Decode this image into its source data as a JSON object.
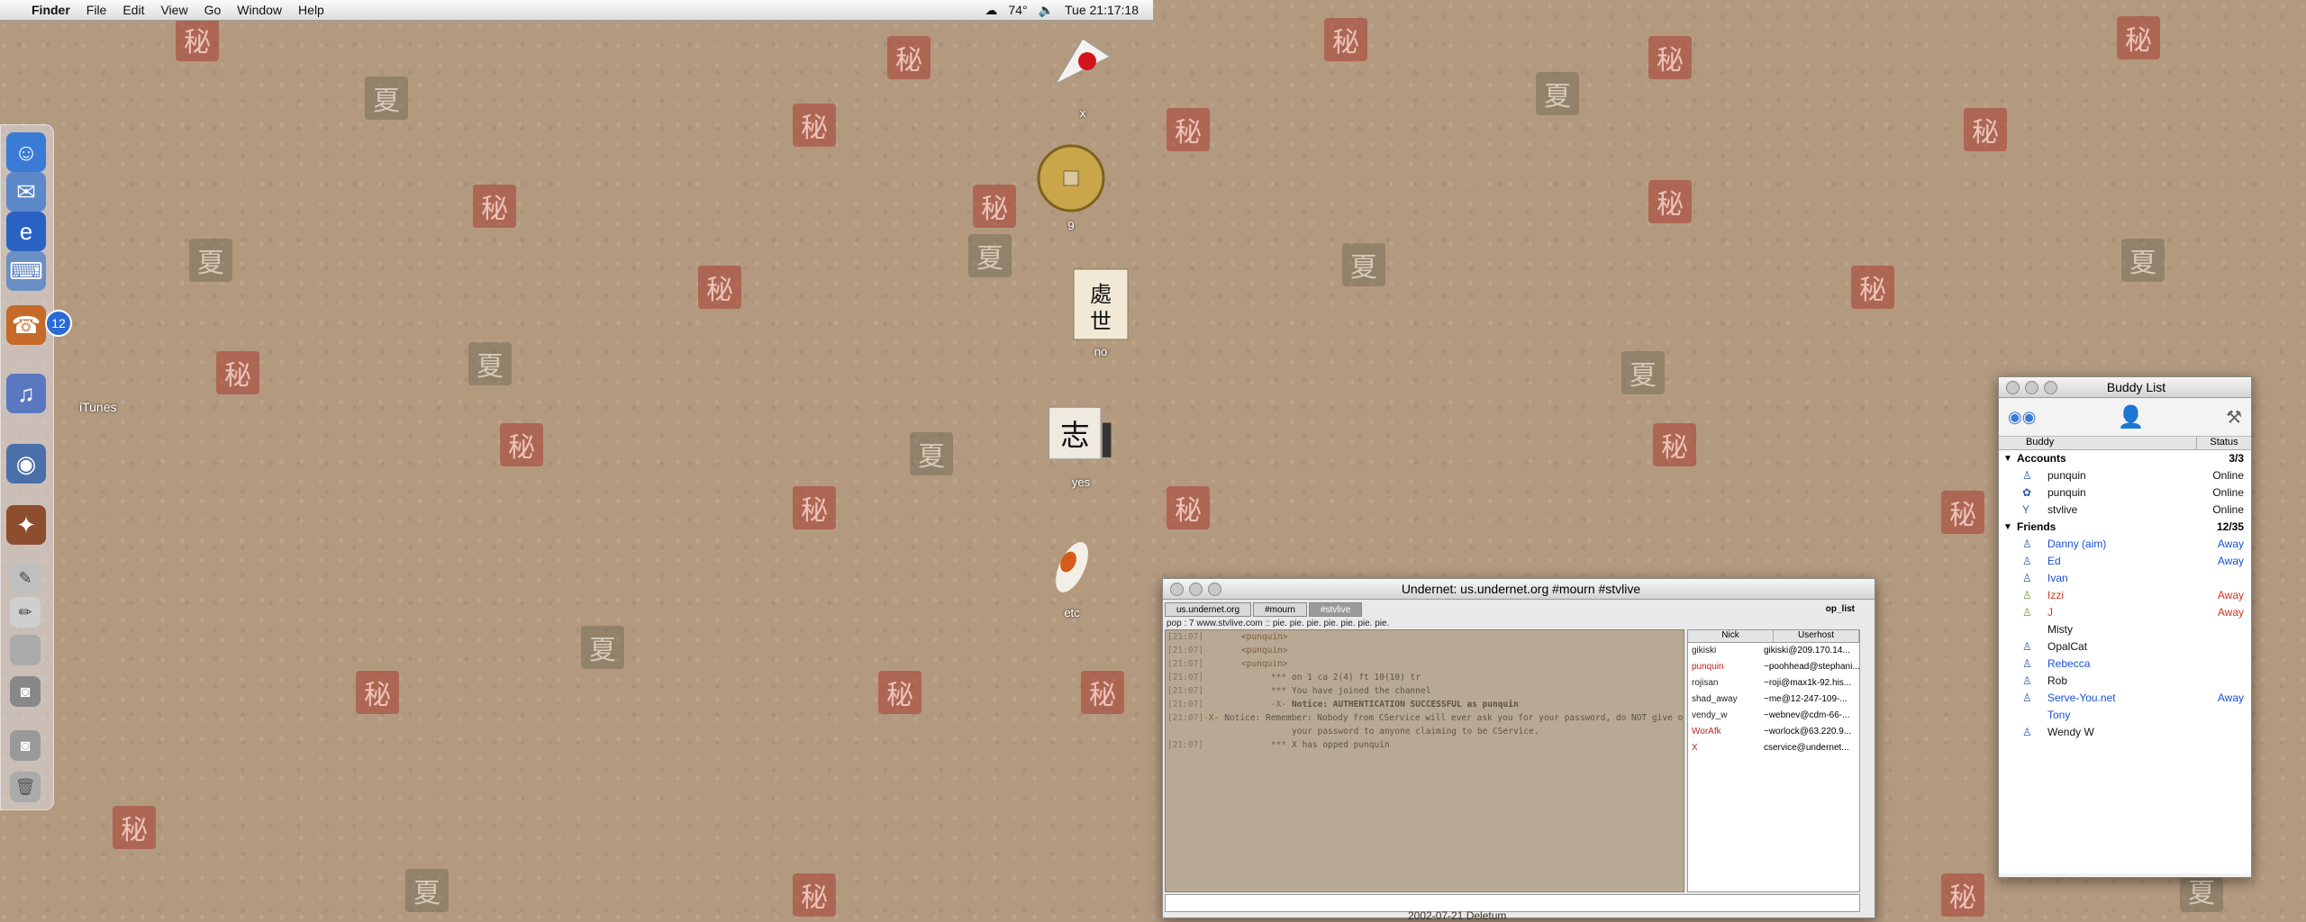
{
  "menubar": {
    "app": "Finder",
    "menus": [
      "File",
      "Edit",
      "View",
      "Go",
      "Window",
      "Help"
    ],
    "temperature": "74°",
    "clock": "Tue 21:17:18"
  },
  "dock": {
    "itunes_label": "iTunes",
    "mail_badge": "12"
  },
  "desktop_icons": [
    {
      "label": "x"
    },
    {
      "label": "9"
    },
    {
      "label": "no"
    },
    {
      "label": "yes"
    },
    {
      "label": "etc"
    }
  ],
  "irc": {
    "title": "Undernet: us.undernet.org #mourn #stvlive",
    "tabs": [
      "us.undernet.org",
      "#mourn",
      "#stvlive"
    ],
    "op_list": "op_list",
    "topic": "pop : 7  www.stvlive.com :: pie. pie. pie. pie. pie. pie. pie.",
    "lines": [
      {
        "ts": "[21:07]",
        "nick": "<punquin>",
        "msg": ""
      },
      {
        "ts": "[21:07]",
        "nick": "<punquin>",
        "msg": ""
      },
      {
        "ts": "[21:07]",
        "nick": "<punquin>",
        "msg": ""
      },
      {
        "ts": "[21:07]",
        "nick": "***",
        "msg": "on 1 ca 2(4) ft 10(10) tr"
      },
      {
        "ts": "[21:07]",
        "nick": "***",
        "msg": "You have joined the channel"
      },
      {
        "ts": "[21:07]",
        "nick": "-X-",
        "msg": "Notice: AUTHENTICATION SUCCESSFUL as punquin"
      },
      {
        "ts": "[21:07]",
        "nick": "-X-",
        "msg": "Notice: Remember: Nobody from CService will ever ask you for your password, do NOT give out"
      },
      {
        "ts": "",
        "nick": "",
        "msg": "your password to anyone claiming to be CService."
      },
      {
        "ts": "[21:07]",
        "nick": "***",
        "msg": "X has opped punquin"
      }
    ],
    "nick_header": {
      "nick": "Nick",
      "host": "Userhost"
    },
    "nicks": [
      {
        "nick": "gikiski",
        "host": "gikiski@209.170.14...",
        "color": "#222222"
      },
      {
        "nick": "punquin",
        "host": "~poohhead@stephani...",
        "color": "#c02020"
      },
      {
        "nick": "rojisan",
        "host": "~roji@max1k-92.his...",
        "color": "#222222"
      },
      {
        "nick": "shad_away",
        "host": "~me@12-247-109-...",
        "color": "#222222"
      },
      {
        "nick": "vendy_w",
        "host": "~webnev@cdm-66-...",
        "color": "#222222"
      },
      {
        "nick": "WorAfk",
        "host": "~worlock@63.220.9...",
        "color": "#c02020"
      },
      {
        "nick": "X",
        "host": "cservice@undernet...",
        "color": "#c02020"
      }
    ],
    "bottom_caption": "2002-07-21 Deletum"
  },
  "buddy_list": {
    "title": "Buddy List",
    "col_buddy": "Buddy",
    "col_status": "Status",
    "groups": [
      {
        "name": "Accounts",
        "count": "3/3",
        "items": [
          {
            "name": "punquin",
            "status": "Online",
            "name_color": "#111111",
            "status_color": "#111111"
          },
          {
            "name": "punquin",
            "status": "Online",
            "name_color": "#111111",
            "status_color": "#111111"
          },
          {
            "name": "stvlive",
            "status": "Online",
            "name_color": "#111111",
            "status_color": "#111111"
          }
        ]
      },
      {
        "name": "Friends",
        "count": "12/35",
        "items": [
          {
            "name": "Danny (aim)",
            "status": "Away",
            "name_color": "#1a4fd0",
            "status_color": "#1a4fd0"
          },
          {
            "name": "Ed",
            "status": "Away",
            "name_color": "#1a4fd0",
            "status_color": "#1a4fd0"
          },
          {
            "name": "Ivan",
            "status": "",
            "name_color": "#1a4fd0",
            "status_color": "#111111"
          },
          {
            "name": "Izzi",
            "status": "Away",
            "name_color": "#d43020",
            "status_color": "#d43020"
          },
          {
            "name": "J",
            "status": "Away",
            "name_color": "#d43020",
            "status_color": "#d43020"
          },
          {
            "name": "Misty",
            "status": "",
            "name_color": "#111111",
            "status_color": "#111111"
          },
          {
            "name": "OpalCat",
            "status": "",
            "name_color": "#111111",
            "status_color": "#111111"
          },
          {
            "name": "Rebecca",
            "status": "",
            "name_color": "#1a4fd0",
            "status_color": "#111111"
          },
          {
            "name": "Rob",
            "status": "",
            "name_color": "#111111",
            "status_color": "#111111"
          },
          {
            "name": "Serve-You.net",
            "status": "Away",
            "name_color": "#1a4fd0",
            "status_color": "#1a4fd0"
          },
          {
            "name": "Tony",
            "status": "",
            "name_color": "#1a4fd0",
            "status_color": "#111111"
          },
          {
            "name": "Wendy W",
            "status": "",
            "name_color": "#111111",
            "status_color": "#111111"
          }
        ]
      }
    ]
  }
}
